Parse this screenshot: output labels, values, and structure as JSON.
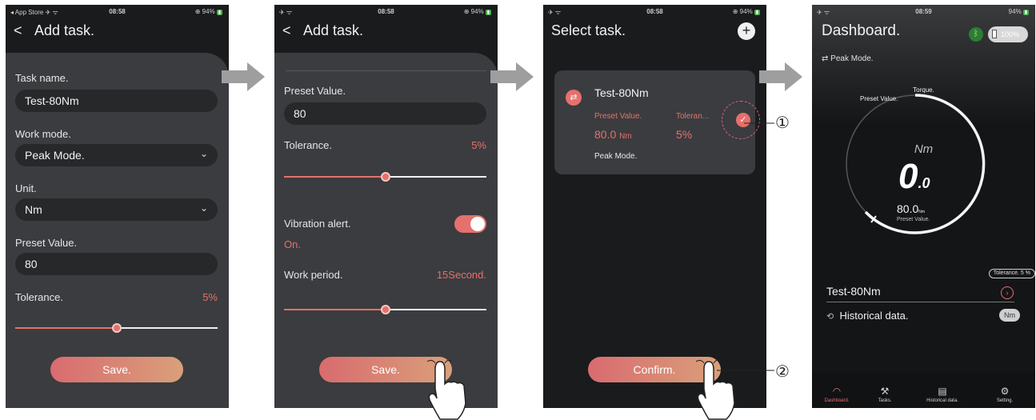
{
  "screens": [
    {
      "status": {
        "left": "◂ App Store ✈ ᯤ",
        "time": "08:58",
        "right": "⊕ 94%"
      },
      "title": "Add task.",
      "back_glyph": "<",
      "fields": {
        "task_name_label": "Task name.",
        "task_name_value": "Test-80Nm",
        "work_mode_label": "Work mode.",
        "work_mode_value": "Peak Mode.",
        "unit_label": "Unit.",
        "unit_value": "Nm",
        "preset_label": "Preset Value.",
        "preset_value": "80",
        "tolerance_label": "Tolerance.",
        "tolerance_value": "5%",
        "tolerance_level": 0.5
      },
      "save_label": "Save."
    },
    {
      "status": {
        "left": "✈ ᯤ",
        "time": "08:58",
        "right": "⊕ 94%"
      },
      "title": "Add task.",
      "back_glyph": "<",
      "fields": {
        "preset_label": "Preset Value.",
        "preset_value": "80",
        "tolerance_label": "Tolerance.",
        "tolerance_value": "5%",
        "tolerance_level": 0.5,
        "vibration_label": "Vibration alert.",
        "vibration_state": "On.",
        "work_period_label": "Work period.",
        "work_period_value": "15Second.",
        "work_period_level": 0.5
      },
      "save_label": "Save."
    },
    {
      "status": {
        "left": "✈ ᯤ",
        "time": "08:58",
        "right": "⊕ 94%"
      },
      "title": "Select task.",
      "add_glyph": "+",
      "card": {
        "name": "Test-80Nm",
        "preset_label": "Preset Value.",
        "tolerance_label": "Toleran...",
        "preset_value": "80.0",
        "preset_unit": "Nm",
        "tolerance_value": "5%",
        "mode": "Peak Mode."
      },
      "confirm_label": "Confirm."
    },
    {
      "status": {
        "left": "✈ ᯤ",
        "time": "08:59",
        "right": "94%"
      },
      "title": "Dashboard.",
      "battery": "100%",
      "mode": "Peak Mode.",
      "gauge": {
        "torque_label": "Torque.",
        "preset_top_label": "Preset Value.",
        "unit": "Nm",
        "reading_main": "0",
        "reading_sub": ".0",
        "preset_value": "80.0",
        "preset_unit": "Nm",
        "preset_bottom_label": "Preset Value."
      },
      "tolerance_chip": "Tolerance. 5 %",
      "task_name": "Test-80Nm",
      "historical_label": "Historical data.",
      "unit_chip": "Nm",
      "tabs": [
        {
          "label": "Dashboard.",
          "icon": "◠"
        },
        {
          "label": "Tasks.",
          "icon": "⚒"
        },
        {
          "label": "Historical data.",
          "icon": "▤"
        },
        {
          "label": "Setting.",
          "icon": "⚙"
        }
      ]
    }
  ],
  "callouts": [
    "①",
    "②"
  ],
  "colors": {
    "accent": "#e6706c",
    "sheet": "#3b3c3f",
    "background": "#1a1b1d",
    "arrow": "#9e9e9e",
    "dashed": "#e35b82"
  }
}
